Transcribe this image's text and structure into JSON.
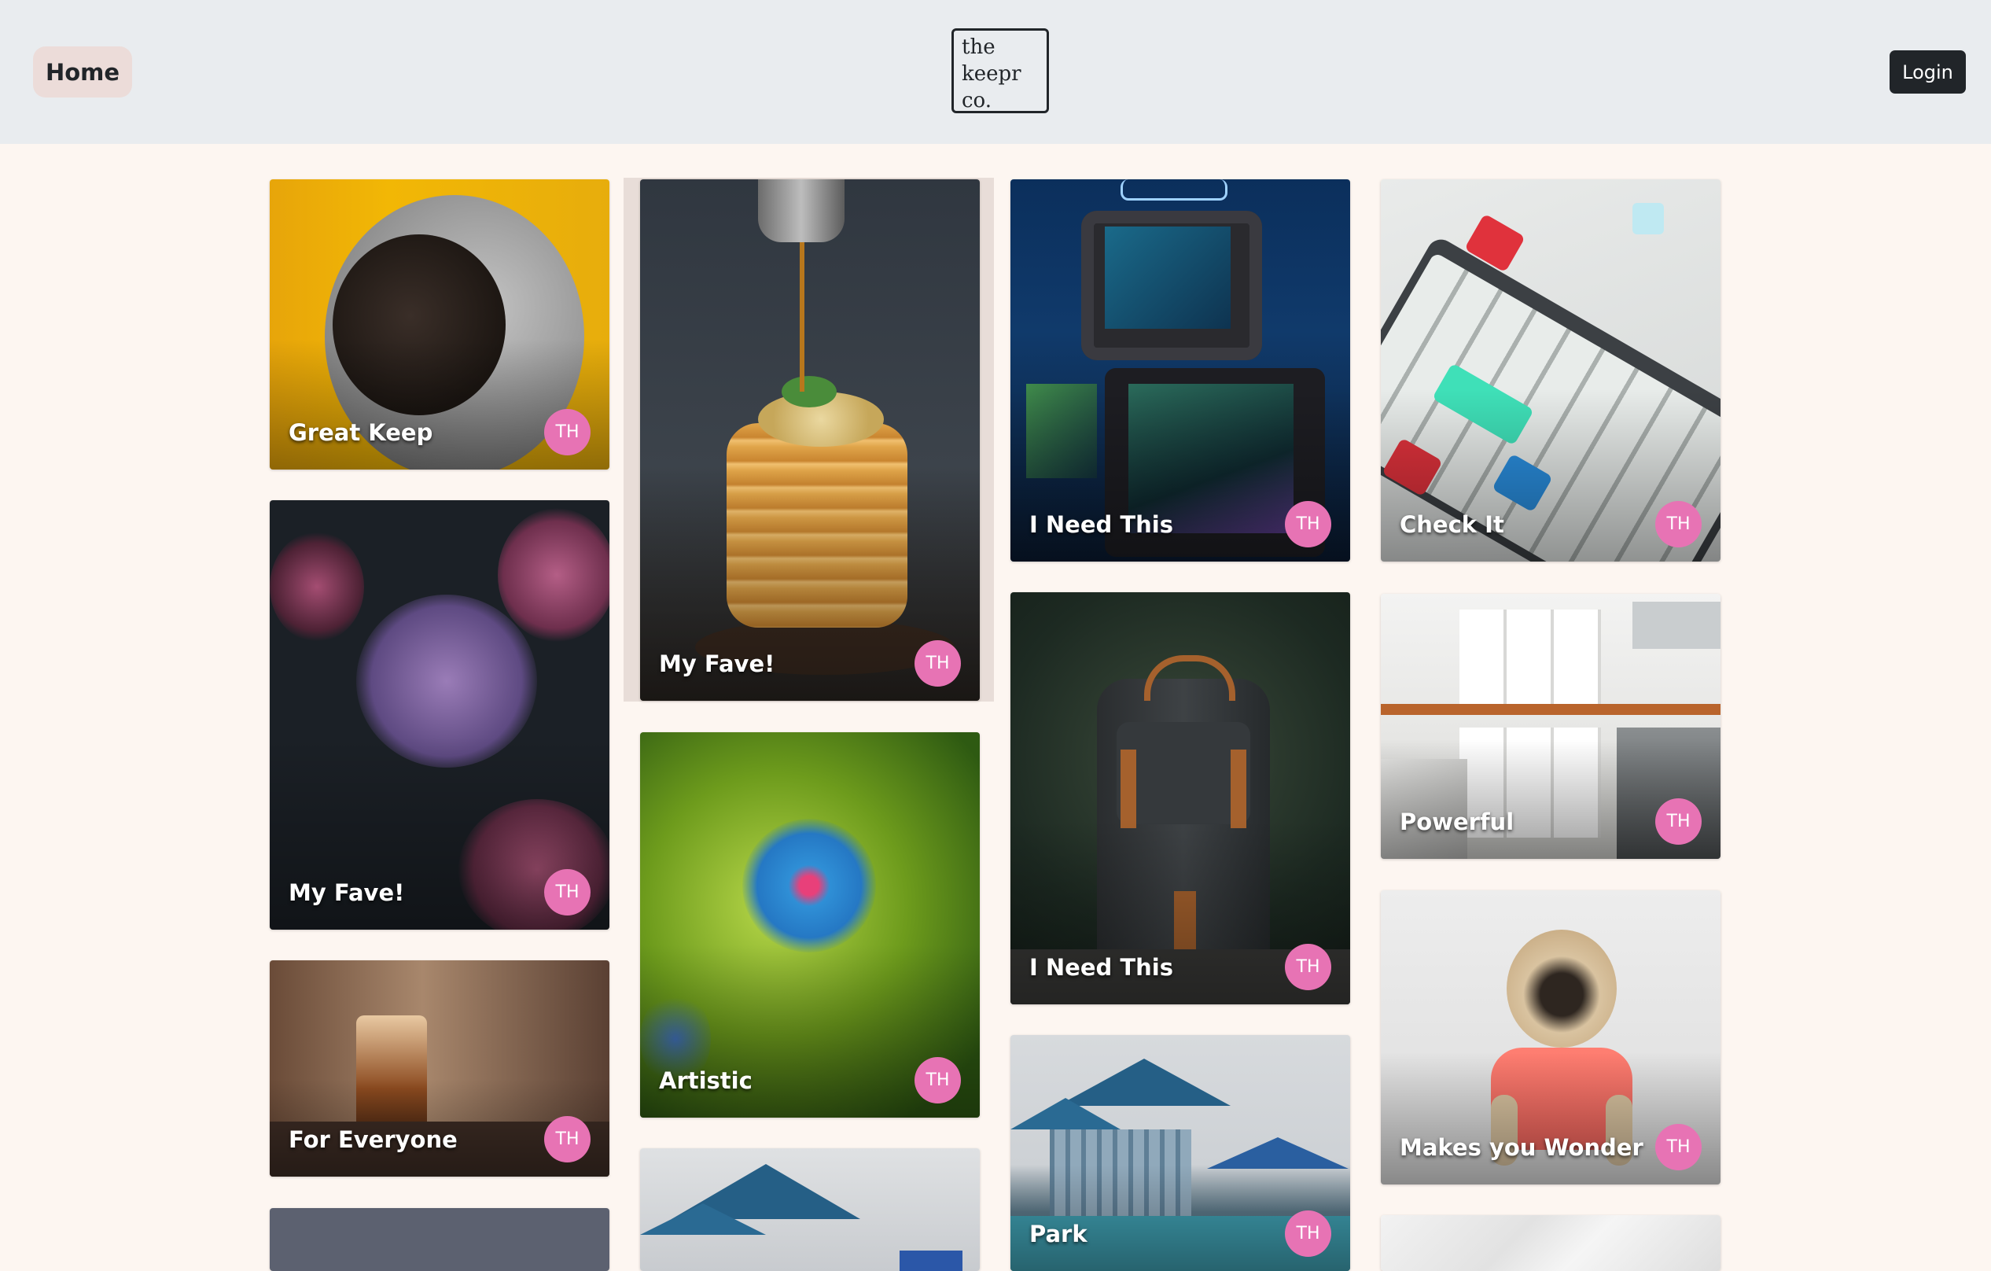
{
  "navbar": {
    "home_label": "Home",
    "logo_lines": [
      "the",
      "keepr",
      "co."
    ],
    "login_label": "Login"
  },
  "keeps": [
    {
      "title": "Great Keep",
      "avatar": "TH",
      "image": "pug in grey hoodie on yellow background"
    },
    {
      "title": "My Fave!",
      "avatar": "TH",
      "image": "purple hydrangea flowers"
    },
    {
      "title": "For Everyone",
      "avatar": "TH",
      "image": "iced coffee glass"
    },
    {
      "title": "",
      "avatar": "",
      "image": "grey patterned card"
    },
    {
      "title": "My Fave!",
      "avatar": "TH",
      "image": "pancake stack with syrup"
    },
    {
      "title": "Artistic",
      "avatar": "TH",
      "image": "blue flower"
    },
    {
      "title": "",
      "avatar": "",
      "image": "playground shade canopies"
    },
    {
      "title": "I Need This",
      "avatar": "TH",
      "image": "retro television sets"
    },
    {
      "title": "I Need This",
      "avatar": "TH",
      "image": "black backpack"
    },
    {
      "title": "Park",
      "avatar": "TH",
      "image": "playground with blue canopies"
    },
    {
      "title": "Check It",
      "avatar": "TH",
      "image": "mechanical keyboard"
    },
    {
      "title": "Powerful",
      "avatar": "TH",
      "image": "white kitchen"
    },
    {
      "title": "Makes you Wonder",
      "avatar": "TH",
      "image": "pug in pink sweater"
    },
    {
      "title": "",
      "avatar": "",
      "image": "marble texture"
    }
  ]
}
